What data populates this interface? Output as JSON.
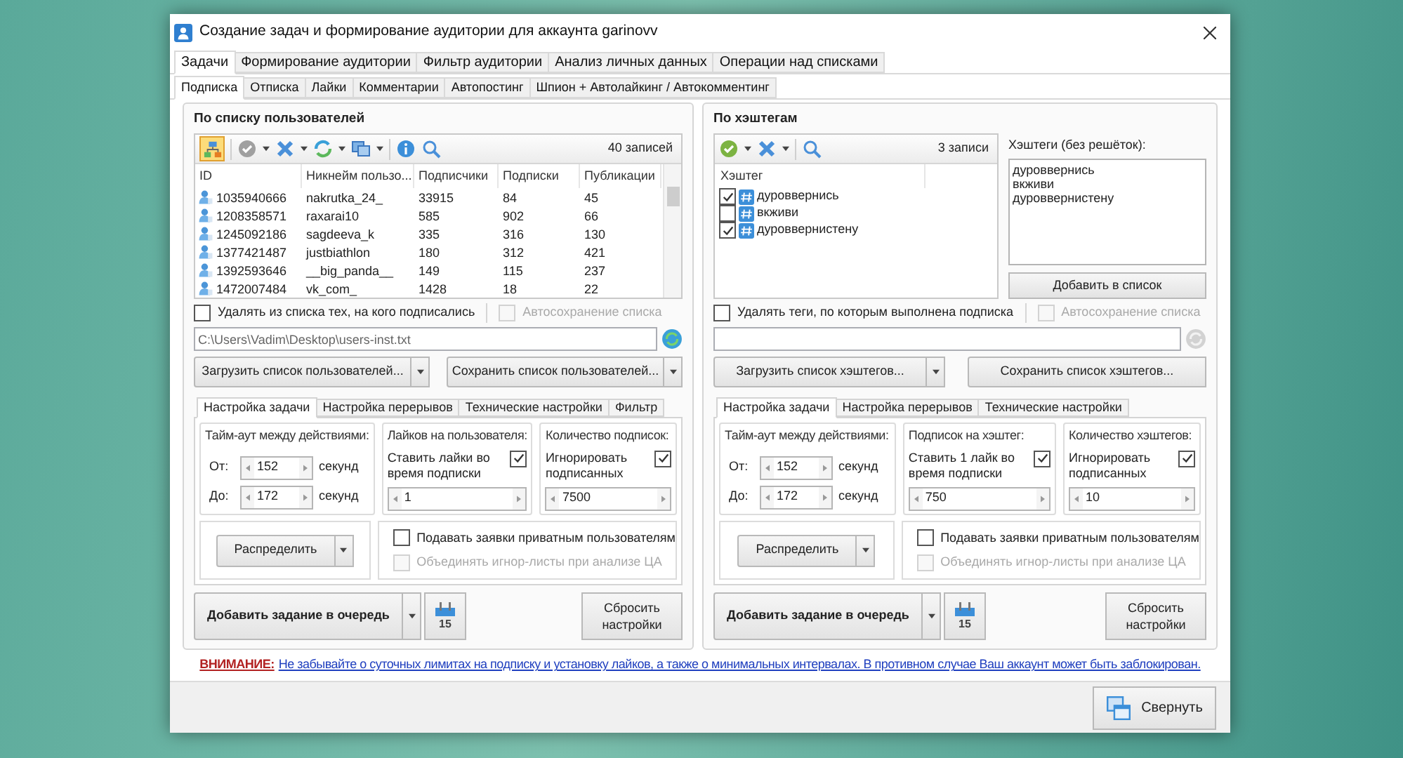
{
  "window": {
    "title": "Создание задач и формирование аудитории для аккаунта garinovv"
  },
  "main_tabs": [
    {
      "label": "Задачи",
      "selected": true
    },
    {
      "label": "Формирование аудитории",
      "selected": false
    },
    {
      "label": "Фильтр аудитории",
      "selected": false
    },
    {
      "label": "Анализ личных данных",
      "selected": false
    },
    {
      "label": "Операции над списками",
      "selected": false
    }
  ],
  "sub_tabs": [
    {
      "label": "Подписка",
      "selected": true
    },
    {
      "label": "Отписка",
      "selected": false
    },
    {
      "label": "Лайки",
      "selected": false
    },
    {
      "label": "Комментарии",
      "selected": false
    },
    {
      "label": "Автопостинг",
      "selected": false
    },
    {
      "label": "Шпион + Автолайкинг / Автокомментинг",
      "selected": false
    }
  ],
  "users_panel": {
    "title": "По списку пользователей",
    "record_count": "40 записей",
    "table": {
      "columns": [
        "ID",
        "Никнейм пользо...",
        "Подписчики",
        "Подписки",
        "Публикации"
      ],
      "rows": [
        [
          "1035940666",
          "nakrutka_24_",
          "33915",
          "84",
          "45"
        ],
        [
          "1208358571",
          "raxarai10",
          "585",
          "902",
          "66"
        ],
        [
          "1245092186",
          "sagdeeva_k",
          "335",
          "316",
          "130"
        ],
        [
          "1377421487",
          "justbiathlon",
          "180",
          "312",
          "421"
        ],
        [
          "1392593646",
          "__big_panda__",
          "149",
          "115",
          "237"
        ],
        [
          "1472007484",
          "vk_com_",
          "1428",
          "18",
          "22"
        ]
      ]
    },
    "remove_option": {
      "label": "Удалять из списка тех, на кого подписались",
      "checked": false,
      "disabled": false
    },
    "autosave_option": {
      "label": "Автосохранение списка",
      "checked": false,
      "disabled": true
    },
    "file_path": "C:\\Users\\Vadim\\Desktop\\users-inst.txt",
    "load_button": {
      "label": "Загрузить список пользователей...",
      "has_menu": true
    },
    "save_button": {
      "label": "Сохранить список пользователей...",
      "has_menu": true
    },
    "settings_tabs": [
      {
        "label": "Настройка задачи",
        "selected": true
      },
      {
        "label": "Настройка перерывов",
        "selected": false
      },
      {
        "label": "Технические настройки",
        "selected": false
      },
      {
        "label": "Фильтр",
        "selected": false
      }
    ],
    "timeout_group": {
      "title": "Тайм-аут между действиями:",
      "rows": [
        {
          "label": "От:",
          "value": "152",
          "unit": "секунд"
        },
        {
          "label": "До:",
          "value": "172",
          "unit": "секунд"
        }
      ]
    },
    "per_item_group": {
      "title": "Лайков на пользователя:",
      "option": {
        "label": "Ставить лайки во время подписки",
        "checked": true
      },
      "value": "1"
    },
    "count_group": {
      "title": "Количество подписок:",
      "option": {
        "label": "Игнорировать подписанных",
        "checked": true
      },
      "value": "7500"
    },
    "distribute_button": "Распределить",
    "options": [
      {
        "label": "Подавать заявки приватным пользователям",
        "checked": false,
        "disabled": false
      },
      {
        "label": "Объединять игнор-листы при анализе ЦА",
        "checked": false,
        "disabled": true
      }
    ],
    "add_task_button": "Добавить задание в очередь",
    "calendar_day": "15",
    "reset_button": "Сбросить настройки"
  },
  "hashtags_panel": {
    "title": "По хэштегам",
    "record_count": "3 записи",
    "list_header": "Хэштег",
    "tags": [
      {
        "label": "дуроввернись",
        "checked": true
      },
      {
        "label": "вкживи",
        "checked": false
      },
      {
        "label": "дуроввернистену",
        "checked": true
      }
    ],
    "hashtags_label": "Хэштеги (без решёток):",
    "hashtags_text": [
      "дуроввернись",
      "вкживи",
      "дуроввернистену"
    ],
    "add_button": "Добавить в список",
    "remove_option": {
      "label": "Удалять теги, по которым выполнена подписка",
      "checked": false,
      "disabled": false
    },
    "autosave_option": {
      "label": "Автосохранение списка",
      "checked": false,
      "disabled": true
    },
    "load_button": {
      "label": "Загрузить список хэштегов...",
      "has_menu": true
    },
    "save_button": {
      "label": "Сохранить список хэштегов...",
      "has_menu": false
    },
    "settings_tabs": [
      {
        "label": "Настройка задачи",
        "selected": true
      },
      {
        "label": "Настройка перерывов",
        "selected": false
      },
      {
        "label": "Технические настройки",
        "selected": false
      }
    ],
    "timeout_group": {
      "title": "Тайм-аут между действиями:",
      "rows": [
        {
          "label": "От:",
          "value": "152",
          "unit": "секунд"
        },
        {
          "label": "До:",
          "value": "172",
          "unit": "секунд"
        }
      ]
    },
    "per_item_group": {
      "title": "Подписок на хэштег:",
      "option": {
        "label": "Ставить 1 лайк во время подписки",
        "checked": true
      },
      "value": "750"
    },
    "count_group": {
      "title": "Количество хэштегов:",
      "option": {
        "label": "Игнорировать подписанных",
        "checked": true
      },
      "value": "10"
    },
    "distribute_button": "Распределить",
    "options": [
      {
        "label": "Подавать заявки приватным пользователям",
        "checked": false,
        "disabled": false
      },
      {
        "label": "Объединять игнор-листы при анализе ЦА",
        "checked": false,
        "disabled": true
      }
    ],
    "add_task_button": "Добавить задание в очередь",
    "calendar_day": "15",
    "reset_button": "Сбросить настройки"
  },
  "warning": {
    "label": "ВНИМАНИЕ:",
    "message": "Не забывайте о суточных лимитах на подписку и установку лайков, а также о минимальных интервалах. В противном случае Ваш аккаунт может быть заблокирован."
  },
  "collapse_button": "Свернуть"
}
